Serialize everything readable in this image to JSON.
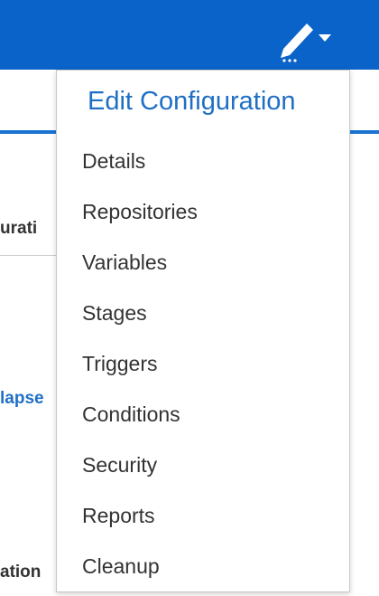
{
  "header": {
    "edit_icon": "pencil-icon",
    "caret_icon": "caret-down-icon",
    "color": "#0a63c9"
  },
  "background": {
    "fragments": [
      "urati",
      "lapse",
      "ation"
    ]
  },
  "dropdown": {
    "title": "Edit Configuration",
    "items": [
      {
        "label": "Details"
      },
      {
        "label": "Repositories"
      },
      {
        "label": "Variables"
      },
      {
        "label": "Stages"
      },
      {
        "label": "Triggers"
      },
      {
        "label": "Conditions"
      },
      {
        "label": "Security"
      },
      {
        "label": "Reports"
      },
      {
        "label": "Cleanup"
      }
    ]
  },
  "colors": {
    "accent": "#1f6fc4",
    "text": "#333333"
  }
}
